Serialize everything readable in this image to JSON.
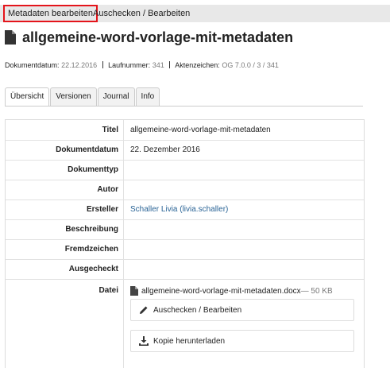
{
  "toolbar": {
    "edit_metadata": "Metadaten bearbeiten",
    "checkout_edit": "Auschecken / Bearbeiten"
  },
  "document": {
    "title": "allgemeine-word-vorlage-mit-metadaten",
    "icon": "document-icon"
  },
  "meta": {
    "date_label": "Dokumentdatum:",
    "date_value": "22.12.2016",
    "number_label": "Laufnummer:",
    "number_value": "341",
    "ref_label": "Aktenzeichen:",
    "ref_value": "OG 7.0.0 / 3 / 341"
  },
  "tabs": [
    {
      "label": "Übersicht",
      "active": true
    },
    {
      "label": "Versionen",
      "active": false
    },
    {
      "label": "Journal",
      "active": false
    },
    {
      "label": "Info",
      "active": false
    }
  ],
  "fields": [
    {
      "label": "Titel",
      "value": "allgemeine-word-vorlage-mit-metadaten"
    },
    {
      "label": "Dokumentdatum",
      "value": "22. Dezember 2016"
    },
    {
      "label": "Dokumenttyp",
      "value": ""
    },
    {
      "label": "Autor",
      "value": ""
    },
    {
      "label": "Ersteller",
      "value": "Schaller Livia (livia.schaller)"
    },
    {
      "label": "Beschreibung",
      "value": ""
    },
    {
      "label": "Fremdzeichen",
      "value": ""
    },
    {
      "label": "Ausgecheckt",
      "value": ""
    },
    {
      "label": "Datei",
      "value": ""
    }
  ],
  "file": {
    "name": "allgemeine-word-vorlage-mit-metadaten.docx",
    "size": "— 50 KB",
    "checkout_button": "Auschecken / Bearbeiten",
    "download_button": "Kopie herunterladen"
  },
  "colors": {
    "highlight": "#e4141b",
    "link": "#2a6496",
    "muted": "#7a7a7a"
  }
}
